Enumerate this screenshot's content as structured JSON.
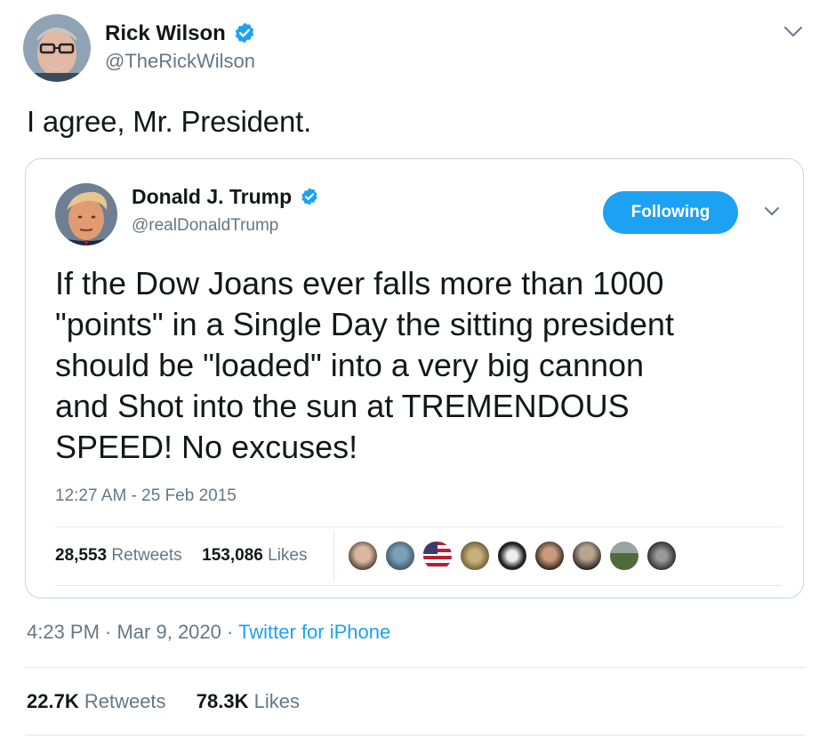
{
  "tweet": {
    "author_name": "Rick Wilson",
    "author_handle": "@TheRickWilson",
    "text": "I agree, Mr. President.",
    "timestamp": "4:23 PM · Mar 9, 2020 · ",
    "source": "Twitter for iPhone",
    "retweets_count": "22.7K",
    "retweets_label": " Retweets",
    "likes_count": "78.3K",
    "likes_label": " Likes",
    "icons": {
      "verified": "verified-badge-icon",
      "menu": "chevron-down-icon"
    }
  },
  "quoted": {
    "author_name": "Donald J. Trump",
    "author_handle": "@realDonaldTrump",
    "follow_label": "Following",
    "text": "If the Dow Joans ever falls more than 1000\n\"points\" in a Single Day the sitting president\nshould be \"loaded\" into a very big cannon\nand Shot into the sun at TREMENDOUS\nSPEED! No excuses!",
    "timestamp": "12:27 AM - 25 Feb 2015",
    "retweets_count": "28,553",
    "retweets_label": " Retweets",
    "likes_count": "153,086",
    "likes_label": " Likes"
  },
  "colors": {
    "accent": "#1da1f2",
    "text": "#14171a",
    "secondary": "#657786",
    "border": "#e1e8ed"
  }
}
